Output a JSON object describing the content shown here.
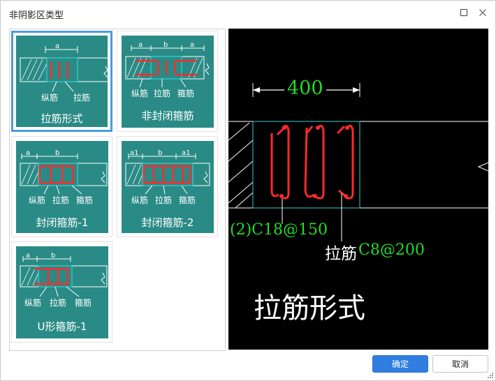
{
  "window": {
    "title": "非阴影区类型"
  },
  "options": [
    {
      "title": "拉筋形式",
      "labels": [
        "纵筋",
        "拉筋"
      ],
      "dims": [
        "a"
      ]
    },
    {
      "title": "非封闭箍筋",
      "labels": [
        "纵筋",
        "拉筋",
        "箍筋"
      ],
      "dims": [
        "a",
        "b",
        "a"
      ]
    },
    {
      "title": "封闭箍筋-1",
      "labels": [
        "纵筋",
        "拉筋",
        "箍筋"
      ],
      "dims": [
        "a",
        "b"
      ]
    },
    {
      "title": "封闭箍筋-2",
      "labels": [
        "纵筋",
        "拉筋",
        "箍筋"
      ],
      "dims": [
        "a1",
        "b",
        "a1"
      ]
    },
    {
      "title": "U形箍筋-1",
      "labels": [
        "纵筋",
        "拉筋",
        "箍筋"
      ],
      "dims": [
        "a",
        "b"
      ]
    }
  ],
  "selected_index": 0,
  "preview": {
    "dimension": "400",
    "longitudinal": "(2)C18@150",
    "tie_label": "拉筋",
    "tie_spec": "C8@200",
    "title": "拉筋形式"
  },
  "buttons": {
    "ok": "确定",
    "cancel": "取消"
  },
  "colors": {
    "accent": "#2f7ee0",
    "card": "#2a8b86",
    "rebar": "#ff2a2a",
    "cad_dim": "#22dd22",
    "cad_outline": "#33cccc"
  }
}
